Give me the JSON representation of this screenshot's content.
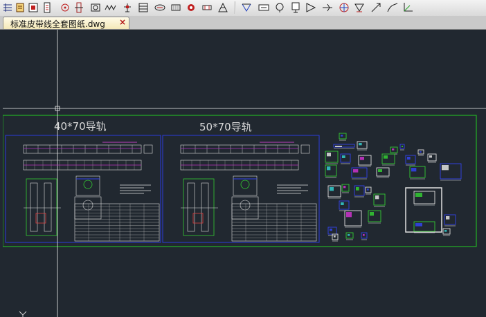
{
  "toolbar": {
    "tools": [
      {
        "icon": "move-icon"
      },
      {
        "icon": "grip-icon"
      },
      {
        "icon": "drawing-frame-icon"
      },
      {
        "icon": "clipboard-icon"
      },
      {
        "icon": "pulley-icon"
      },
      {
        "icon": "roller-icon"
      },
      {
        "icon": "image-icon"
      },
      {
        "icon": "belt-wave-icon"
      },
      {
        "icon": "support-icon"
      },
      {
        "icon": "frame-icon"
      },
      {
        "icon": "drum-icon"
      },
      {
        "icon": "motor-icon"
      },
      {
        "icon": "reducer-icon"
      },
      {
        "icon": "coupling-icon"
      },
      {
        "icon": "truss-icon"
      },
      {
        "icon": "dimension-icon"
      },
      {
        "icon": "block-number-icon"
      },
      {
        "icon": "balloon-icon"
      },
      {
        "icon": "annotation-icon"
      },
      {
        "icon": "arrow-flag-icon"
      },
      {
        "icon": "weld-symbol-icon"
      },
      {
        "icon": "datum-target-icon"
      },
      {
        "icon": "surface-finish-icon"
      },
      {
        "icon": "leader-icon"
      },
      {
        "icon": "curve-icon"
      },
      {
        "icon": "axes-icon"
      }
    ]
  },
  "tab": {
    "title": "标准皮带线全套图纸.dwg",
    "close": "×"
  },
  "drawing": {
    "label_left": "40*70导轨",
    "label_right": "50*70导轨"
  },
  "colors": {
    "canvas": "#212830",
    "frame_green": "#22cc22",
    "frame_blue": "#2233cc",
    "crosshair": "#ffffff"
  }
}
